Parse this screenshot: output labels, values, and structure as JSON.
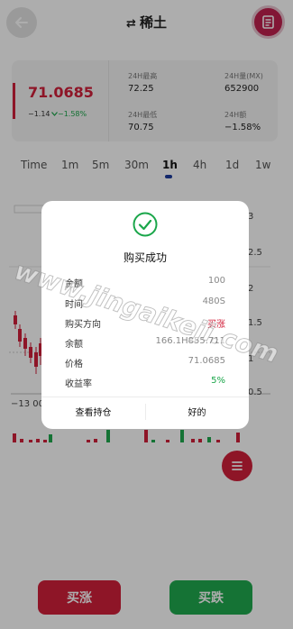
{
  "header": {
    "title": "稀土",
    "swap_icon": "⇄",
    "back_icon": "back-arrow-icon",
    "orders_icon": "order-book-icon"
  },
  "price_card": {
    "price": "71.0685",
    "change": "−1.14",
    "change_pct": "−1.58%",
    "stats": [
      {
        "label": "24H最高",
        "value": "72.25"
      },
      {
        "label": "24H量(MX)",
        "value": "652900"
      },
      {
        "label": "24H最低",
        "value": "70.75"
      },
      {
        "label": "24H额",
        "value": "−1.58%"
      }
    ]
  },
  "timeframes": [
    "Time",
    "1m",
    "5m",
    "30m",
    "1h",
    "4h",
    "1d",
    "1w"
  ],
  "active_timeframe": "1h",
  "chart": {
    "y_ticks": [
      "3",
      "2.5",
      "2",
      "1.5",
      "1",
      "0.5"
    ],
    "x_tick": "−13 00"
  },
  "buttons": {
    "buy": "买涨",
    "sell": "买跌"
  },
  "dialog": {
    "title": "购买成功",
    "rows": [
      {
        "label": "金额",
        "value": "100"
      },
      {
        "label": "时间",
        "value": "480S"
      },
      {
        "label": "购买方向",
        "value": "买涨"
      },
      {
        "label": "余额",
        "value": "166.1H855.711"
      },
      {
        "label": "价格",
        "value": "71.0685"
      },
      {
        "label": "收益率",
        "value": "5%"
      }
    ],
    "view_btn": "查看持仓",
    "ok_btn": "好的"
  },
  "watermark": "www.jingaikeji.com",
  "colors": {
    "up": "#d11f3a",
    "down": "#1aa64a",
    "accent": "#1d3c9e"
  }
}
